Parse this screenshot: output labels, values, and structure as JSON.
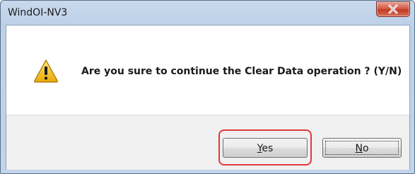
{
  "window": {
    "title": "WindOI-NV3"
  },
  "dialog": {
    "message": "Are you sure to continue the Clear Data operation ? (Y/N)"
  },
  "buttons": {
    "yes": {
      "mnemonic": "Y",
      "rest": "es"
    },
    "no": {
      "mnemonic": "N",
      "rest": "o"
    }
  },
  "icons": {
    "message_icon": "warning-icon",
    "close": "close-icon"
  },
  "colors": {
    "highlight": "#e03a3a",
    "close_button": "#c23a22",
    "warning_fill": "#f5c517"
  }
}
